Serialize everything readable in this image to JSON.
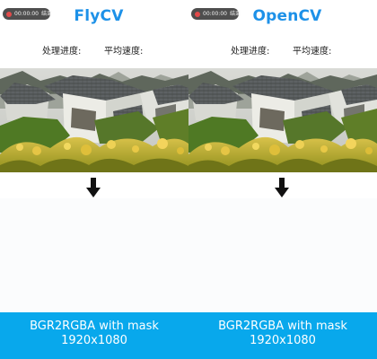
{
  "panels": [
    {
      "recorder": {
        "time": "00:00:00",
        "end_label": "结束"
      },
      "title": "FlyCV",
      "progress_label": "处理进度:",
      "speed_label": "平均速度:",
      "footer": {
        "operation": "BGR2RGBA with mask",
        "resolution": "1920x1080"
      }
    },
    {
      "recorder": {
        "time": "00:00:00",
        "end_label": "结束"
      },
      "title": "OpenCV",
      "progress_label": "处理进度:",
      "speed_label": "平均速度:",
      "footer": {
        "operation": "BGR2RGBA with mask",
        "resolution": "1920x1080"
      }
    }
  ],
  "colors": {
    "title": "#1d91e8",
    "footer": "#08a8ec",
    "recording_dot": "#e24a4a",
    "recorder_pill": "#4e4e4e"
  },
  "icons": {
    "recording": "record-dot-icon",
    "conversion_arrow": "arrow-down-icon"
  }
}
